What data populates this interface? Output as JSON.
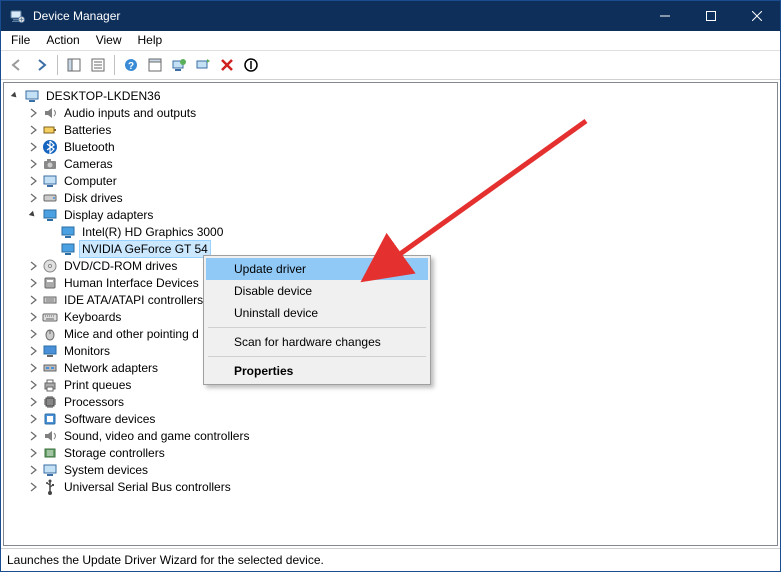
{
  "window": {
    "title": "Device Manager"
  },
  "menu": {
    "file": "File",
    "action": "Action",
    "view": "View",
    "help": "Help"
  },
  "tree": {
    "root": "DESKTOP-LKDEN36",
    "n_audio": "Audio inputs and outputs",
    "n_batteries": "Batteries",
    "n_bluetooth": "Bluetooth",
    "n_cameras": "Cameras",
    "n_computer": "Computer",
    "n_disk": "Disk drives",
    "n_display": "Display adapters",
    "n_intel": "Intel(R) HD Graphics 3000",
    "n_nvidia": "NVIDIA GeForce GT 54",
    "n_dvd": "DVD/CD-ROM drives",
    "n_hid": "Human Interface Devices",
    "n_ide": "IDE ATA/ATAPI controllers",
    "n_keyboards": "Keyboards",
    "n_mice": "Mice and other pointing d",
    "n_monitors": "Monitors",
    "n_network": "Network adapters",
    "n_printq": "Print queues",
    "n_processors": "Processors",
    "n_software": "Software devices",
    "n_sound": "Sound, video and game controllers",
    "n_storage": "Storage controllers",
    "n_system": "System devices",
    "n_usb": "Universal Serial Bus controllers"
  },
  "context_menu": {
    "update": "Update driver",
    "disable": "Disable device",
    "uninstall": "Uninstall device",
    "scan": "Scan for hardware changes",
    "properties": "Properties"
  },
  "status": {
    "text": "Launches the Update Driver Wizard for the selected device."
  }
}
